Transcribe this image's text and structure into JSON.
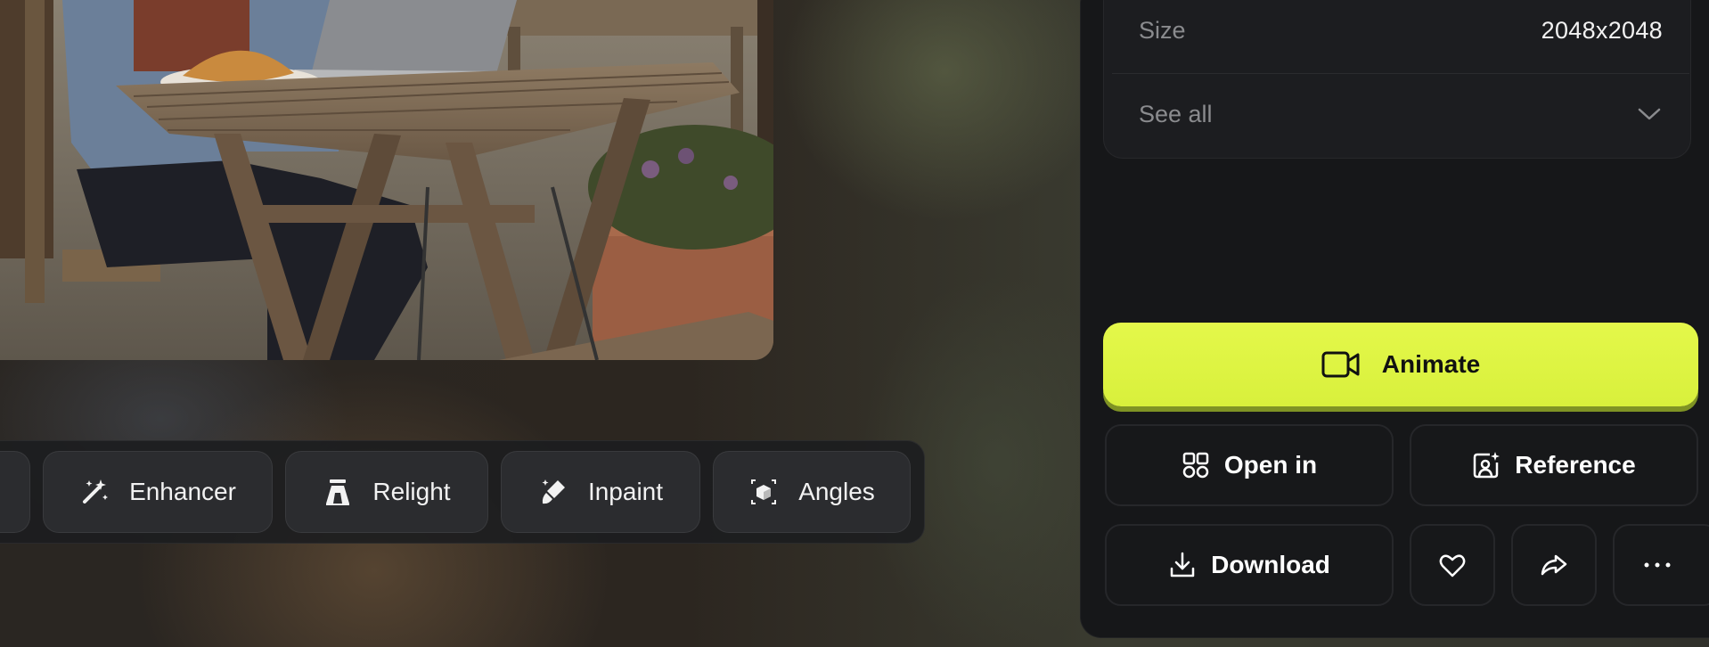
{
  "info": {
    "size_label": "Size",
    "size_value": "2048x2048",
    "see_all_label": "See all"
  },
  "tools": [
    {
      "label": "Enhancer",
      "icon": "magic-wand-icon"
    },
    {
      "label": "Relight",
      "icon": "relight-icon"
    },
    {
      "label": "Inpaint",
      "icon": "brush-icon"
    },
    {
      "label": "Angles",
      "icon": "cube-icon"
    }
  ],
  "actions": {
    "animate_label": "Animate",
    "open_in_label": "Open in",
    "reference_label": "Reference",
    "download_label": "Download"
  },
  "colors": {
    "accent": "#e2f74a",
    "panel": "#161719",
    "button": "#17181a"
  }
}
